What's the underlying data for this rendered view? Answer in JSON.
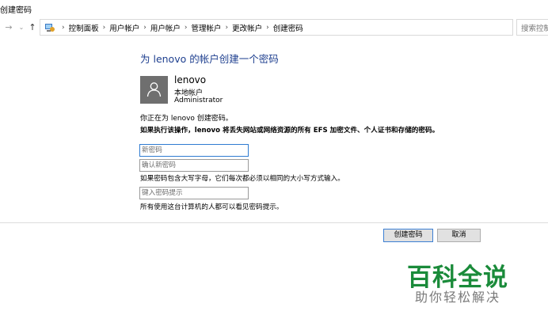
{
  "window": {
    "title": "创建密码"
  },
  "address_bar": {
    "breadcrumbs": [
      "控制面板",
      "用户帐户",
      "用户帐户",
      "管理帐户",
      "更改帐户",
      "创建密码"
    ],
    "search_placeholder": "搜索控制面板"
  },
  "page": {
    "heading": "为 lenovo 的帐户创建一个密码",
    "account": {
      "name": "lenovo",
      "type": "本地帐户",
      "role": "Administrator"
    },
    "intro": "你正在为 lenovo 创建密码。",
    "warning": "如果执行该操作，lenovo 将丢失网站或网络资源的所有 EFS 加密文件、个人证书和存储的密码。",
    "new_password_placeholder": "新密码",
    "confirm_password_placeholder": "确认新密码",
    "case_hint": "如果密码包含大写字母，它们每次都必须以相同的大小写方式输入。",
    "hint_placeholder": "键入密码提示",
    "hint_note": "所有使用这台计算机的人都可以看见密码提示。"
  },
  "buttons": {
    "create": "创建密码",
    "cancel": "取消"
  },
  "watermark": {
    "title": "百科全说",
    "subtitle": "助你轻松解决"
  },
  "colors": {
    "heading": "#1e3f8f",
    "focus_border": "#2e7bd1",
    "watermark": "#1a8b3a"
  }
}
